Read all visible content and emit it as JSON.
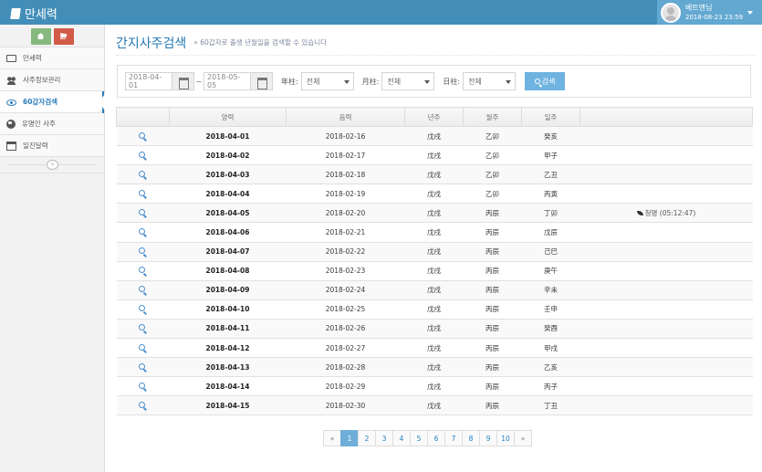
{
  "app": {
    "title": "만세력",
    "user_name": "베트맨님",
    "user_datetime": "2018-08-23 23:59",
    "accent_color": "#438eb9"
  },
  "sidebar": {
    "shortcuts": [
      {
        "icon": "home-icon"
      },
      {
        "icon": "cart-icon"
      }
    ],
    "items": [
      {
        "label": "만세력",
        "icon": "monitor-icon"
      },
      {
        "label": "사주정보관리",
        "icon": "users-icon"
      },
      {
        "label": "60갑자검색",
        "icon": "eye-icon",
        "active": true
      },
      {
        "label": "유명인 사주",
        "icon": "globe-icon"
      },
      {
        "label": "일진달력",
        "icon": "calendar-icon"
      }
    ],
    "collapse_label": "«"
  },
  "page": {
    "title": "간지사주검색",
    "subtitle": "» 60갑자로 출생 년월일을 검색할 수 있습니다"
  },
  "search": {
    "start_date": "2018-04-01",
    "separator": "~",
    "end_date": "2018-05-05",
    "year_label": "年柱:",
    "year_value": "전체",
    "month_label": "月柱:",
    "month_value": "전체",
    "day_label": "日柱:",
    "day_value": "전체",
    "button_label": "검색"
  },
  "table": {
    "headers": [
      "",
      "양력",
      "음력",
      "년주",
      "월주",
      "일주",
      ""
    ],
    "rows": [
      {
        "solar": "2018-04-01",
        "lunar": "2018-02-16",
        "year": "戊戌",
        "month": "乙卯",
        "day": "癸亥",
        "note": ""
      },
      {
        "solar": "2018-04-02",
        "lunar": "2018-02-17",
        "year": "戊戌",
        "month": "乙卯",
        "day": "甲子",
        "note": ""
      },
      {
        "solar": "2018-04-03",
        "lunar": "2018-02-18",
        "year": "戊戌",
        "month": "乙卯",
        "day": "乙丑",
        "note": ""
      },
      {
        "solar": "2018-04-04",
        "lunar": "2018-02-19",
        "year": "戊戌",
        "month": "乙卯",
        "day": "丙寅",
        "note": ""
      },
      {
        "solar": "2018-04-05",
        "lunar": "2018-02-20",
        "year": "戊戌",
        "month": "丙辰",
        "day": "丁卯",
        "note": "청명 (05:12:47)"
      },
      {
        "solar": "2018-04-06",
        "lunar": "2018-02-21",
        "year": "戊戌",
        "month": "丙辰",
        "day": "戊辰",
        "note": ""
      },
      {
        "solar": "2018-04-07",
        "lunar": "2018-02-22",
        "year": "戊戌",
        "month": "丙辰",
        "day": "己巳",
        "note": ""
      },
      {
        "solar": "2018-04-08",
        "lunar": "2018-02-23",
        "year": "戊戌",
        "month": "丙辰",
        "day": "庚午",
        "note": ""
      },
      {
        "solar": "2018-04-09",
        "lunar": "2018-02-24",
        "year": "戊戌",
        "month": "丙辰",
        "day": "辛未",
        "note": ""
      },
      {
        "solar": "2018-04-10",
        "lunar": "2018-02-25",
        "year": "戊戌",
        "month": "丙辰",
        "day": "壬申",
        "note": ""
      },
      {
        "solar": "2018-04-11",
        "lunar": "2018-02-26",
        "year": "戊戌",
        "month": "丙辰",
        "day": "癸酉",
        "note": ""
      },
      {
        "solar": "2018-04-12",
        "lunar": "2018-02-27",
        "year": "戊戌",
        "month": "丙辰",
        "day": "甲戌",
        "note": ""
      },
      {
        "solar": "2018-04-13",
        "lunar": "2018-02-28",
        "year": "戊戌",
        "month": "丙辰",
        "day": "乙亥",
        "note": ""
      },
      {
        "solar": "2018-04-14",
        "lunar": "2018-02-29",
        "year": "戊戌",
        "month": "丙辰",
        "day": "丙子",
        "note": ""
      },
      {
        "solar": "2018-04-15",
        "lunar": "2018-02-30",
        "year": "戊戌",
        "month": "丙辰",
        "day": "丁丑",
        "note": ""
      }
    ]
  },
  "pagination": {
    "prev": "«",
    "pages": [
      "1",
      "2",
      "3",
      "4",
      "5",
      "6",
      "7",
      "8",
      "9",
      "10"
    ],
    "current": "1",
    "next": "»"
  }
}
